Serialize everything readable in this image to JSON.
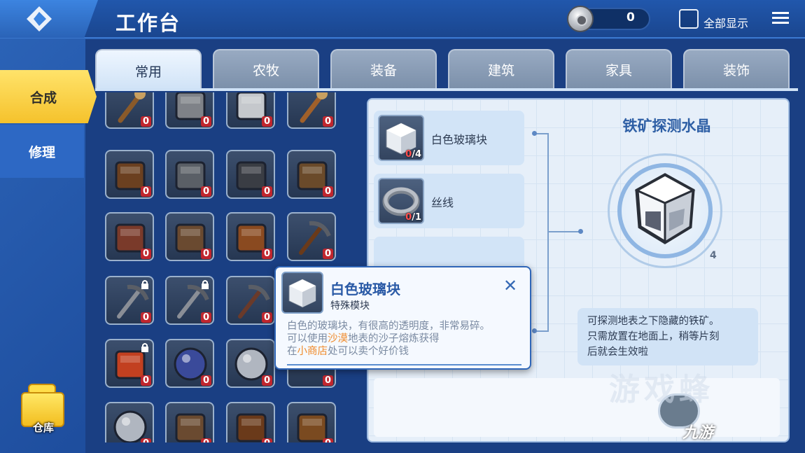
{
  "header": {
    "title": "工作台",
    "coin_count": "0",
    "show_all_label": "全部显示"
  },
  "nav": {
    "synthesis": "合成",
    "repair": "修理",
    "warehouse": "仓库"
  },
  "tabs": [
    "常用",
    "农牧",
    "装备",
    "建筑",
    "家具",
    "装饰"
  ],
  "grid": {
    "counts": [
      "0",
      "0",
      "0",
      "0",
      "0",
      "0",
      "0",
      "0",
      "0",
      "0",
      "0",
      "0",
      "0",
      "0",
      "0",
      "0",
      "0",
      "0",
      "0",
      "0",
      "0",
      "0",
      "0",
      "0"
    ],
    "items": [
      "torch-icon",
      "helmet-icon",
      "funnel-icon",
      "torch-flame-icon",
      "fence-icon",
      "furnace-icon",
      "machine-icon",
      "anvil-icon",
      "bookshelf-icon",
      "workbench-icon",
      "chest-icon",
      "pickaxe-icon",
      "locked-pickaxe-icon",
      "locked-pickaxe-icon",
      "axe-icon",
      "",
      "locked-horn-icon",
      "blue-orb-icon",
      "glass-orb-icon",
      "",
      "glass-jar-icon",
      "bed-icon",
      "door-icon",
      "window-icon"
    ]
  },
  "materials": [
    {
      "name": "白色玻璃块",
      "have": "0",
      "need": "/4",
      "icon": "glass-block-icon"
    },
    {
      "name": "丝线",
      "have": "0",
      "need": "/1",
      "icon": "string-coil-icon"
    }
  ],
  "result": {
    "title": "铁矿探测水晶",
    "count": "4",
    "description": [
      "可探测地表之下隐藏的铁矿。",
      "只需放置在地面上，稍等片刻",
      "后就会生效啦"
    ]
  },
  "tooltip": {
    "name": "白色玻璃块",
    "subtitle": "特殊模块",
    "line1": "白色的玻璃块，有很高的透明度，非常易碎。",
    "line2_pre": "可以使用",
    "line2_hl": "沙漠",
    "line2_post": "地表的沙子熔炼获得",
    "line3_pre": "在",
    "line3_hl": "小商店",
    "line3_post": "处可以卖个好价钱",
    "close": "✕"
  },
  "watermark": {
    "text": "九游",
    "faded": "游戏蜂"
  }
}
